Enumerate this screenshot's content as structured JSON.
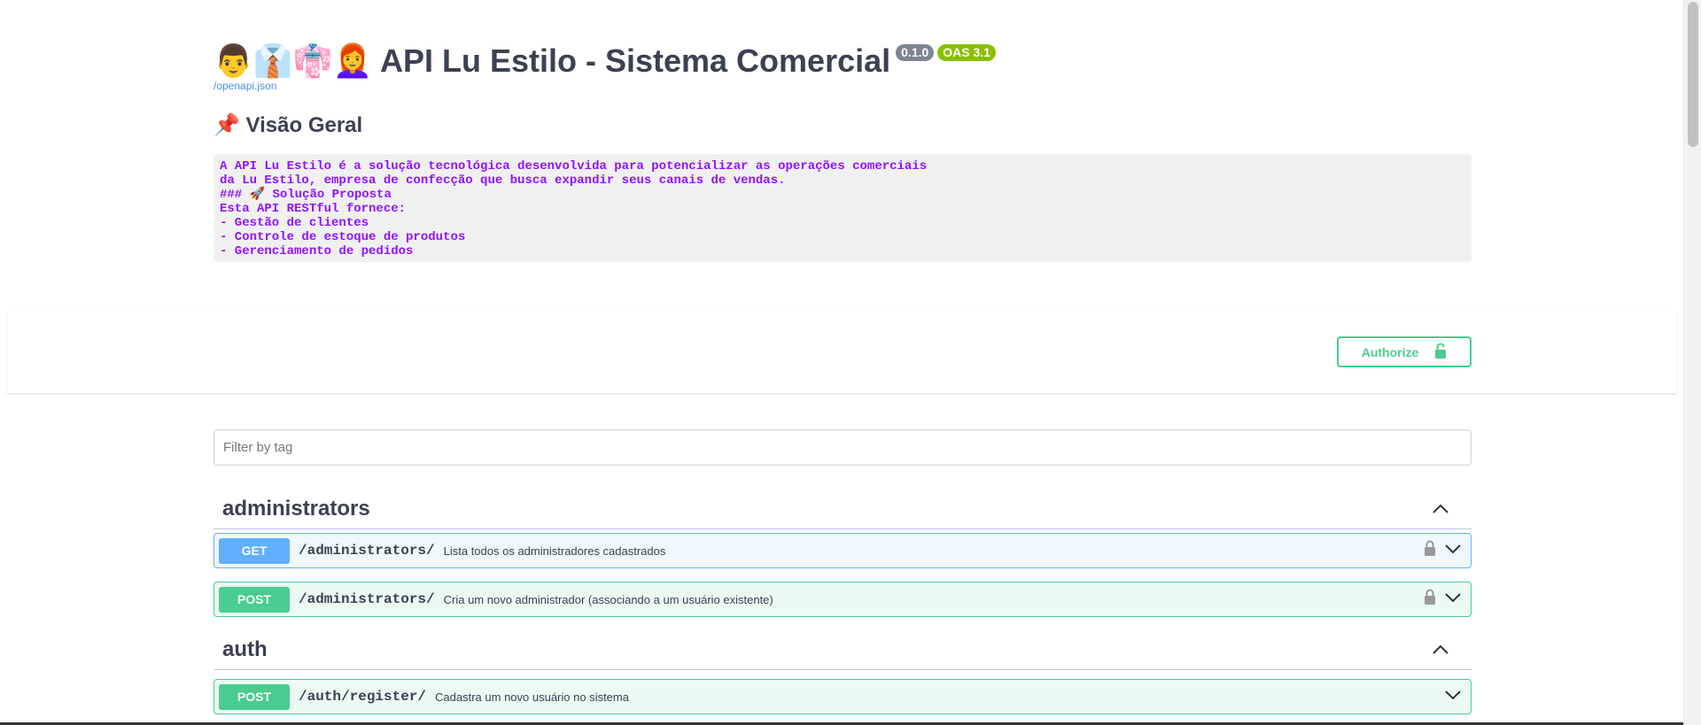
{
  "info": {
    "emoji": "👨👔👘👩‍🦰",
    "title": "API Lu Estilo - Sistema Comercial",
    "version_badge": "0.1.0",
    "oas_badge": "OAS 3.1",
    "spec_link": "/openapi.json",
    "overview_heading": "📌 Visão Geral",
    "description": "A API Lu Estilo é a solução tecnológica desenvolvida para potencializar as operações comerciais\nda Lu Estilo, empresa de confecção que busca expandir seus canais de vendas.\n### 🚀 Solução Proposta\nEsta API RESTful fornece:\n- Gestão de clientes\n- Controle de estoque de produtos\n- Gerenciamento de pedidos"
  },
  "auth": {
    "authorize_label": "Authorize"
  },
  "filter": {
    "placeholder": "Filter by tag"
  },
  "colors": {
    "get": "#61affe",
    "post": "#49cc90",
    "description_text": "#9012fe"
  },
  "tags": [
    {
      "name": "administrators",
      "operations": [
        {
          "method": "GET",
          "path": "/administrators/",
          "summary": "Lista todos os administradores cadastrados",
          "locked": true
        },
        {
          "method": "POST",
          "path": "/administrators/",
          "summary": "Cria um novo administrador (associando a um usuário existente)",
          "locked": true
        }
      ]
    },
    {
      "name": "auth",
      "operations": [
        {
          "method": "POST",
          "path": "/auth/register/",
          "summary": "Cadastra um novo usuário no sistema",
          "locked": false
        }
      ]
    }
  ]
}
